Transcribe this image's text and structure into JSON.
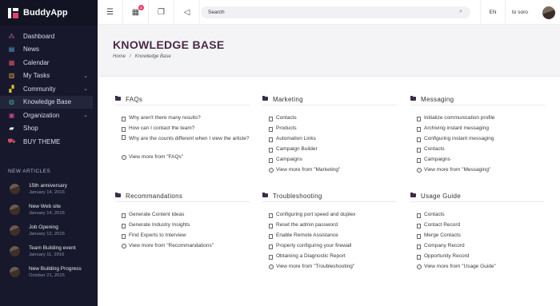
{
  "app": {
    "name": "BuddyApp"
  },
  "sidebar": {
    "items": [
      {
        "label": "Dashboard",
        "icon": "dashboard-icon",
        "color": "#c15ba1",
        "chevron": false,
        "active": false
      },
      {
        "label": "News",
        "icon": "news-icon",
        "color": "#5aa0e0",
        "chevron": false,
        "active": false
      },
      {
        "label": "Calendar",
        "icon": "calendar-icon",
        "color": "#e0506b",
        "chevron": false,
        "active": false
      },
      {
        "label": "My Tasks",
        "icon": "tasks-icon",
        "color": "#e8a33d",
        "chevron": true,
        "active": false
      },
      {
        "label": "Community",
        "icon": "community-icon",
        "color": "#d9c22e",
        "chevron": true,
        "active": false
      },
      {
        "label": "Knowledge Base",
        "icon": "globe-icon",
        "color": "#39b98a",
        "chevron": false,
        "active": true
      },
      {
        "label": "Organization",
        "icon": "organization-icon",
        "color": "#c04a8e",
        "chevron": true,
        "active": false
      },
      {
        "label": "Shop",
        "icon": "shop-icon",
        "color": "#ffffff",
        "chevron": false,
        "active": false
      },
      {
        "label": "BUY THEME",
        "icon": "cart-icon",
        "color": "#e0506b",
        "chevron": false,
        "active": false
      }
    ]
  },
  "new_articles": {
    "title": "NEW ARTICLES",
    "items": [
      {
        "title": "15th anniversary",
        "date": "January 14, 2016"
      },
      {
        "title": "New Web site",
        "date": "January 14, 2016"
      },
      {
        "title": "Job Opening",
        "date": "January 12, 2016"
      },
      {
        "title": "Team Building event",
        "date": "January 11, 2016"
      },
      {
        "title": "New Building Progress",
        "date": "October 21, 2015"
      }
    ]
  },
  "topbar": {
    "badge_count": "2",
    "search_placeholder": "Search",
    "language": "EN",
    "user": "to soro"
  },
  "header": {
    "title": "KNOWLEDGE BASE",
    "breadcrumb": {
      "home": "Home",
      "separator": "/",
      "current": "Knowledge Base"
    }
  },
  "sections": [
    {
      "title": "FAQs",
      "items": [
        "Why aren't there many results?",
        "How can I contact the team?",
        "Why are the counts different when I view the article?"
      ],
      "more": "View more from \"FAQs\""
    },
    {
      "title": "Marketing",
      "items": [
        "Contacts",
        "Products",
        "Automation Links",
        "Campaign Builder",
        "Campaigns"
      ],
      "more": "View more from \"Marketing\""
    },
    {
      "title": "Messaging",
      "items": [
        "Initialize communication profile",
        "Archiving instant messaging",
        "Configuring instant messaging",
        "Contacts",
        "Campaigns"
      ],
      "more": "View more from \"Messaging\""
    },
    {
      "title": "Recommandations",
      "items": [
        "Generate Content Ideas",
        "Generate Industry Insights",
        "Find Experts to Interview"
      ],
      "more": "View more from \"Recommandations\""
    },
    {
      "title": "Troubleshooting",
      "items": [
        "Configuring port speed and duplex",
        "Reset the admin password",
        "Enable Remote Assistance",
        "Properly configuring your firewall",
        "Obtaining a Diagnostic Report"
      ],
      "more": "View more from \"Troubleshooting\""
    },
    {
      "title": "Usage Guide",
      "items": [
        "Contacts",
        "Contact Record",
        "Merge Contacts",
        "Company Record",
        "Opportunity Record"
      ],
      "more": "View more from \"Usage Guide\""
    }
  ]
}
